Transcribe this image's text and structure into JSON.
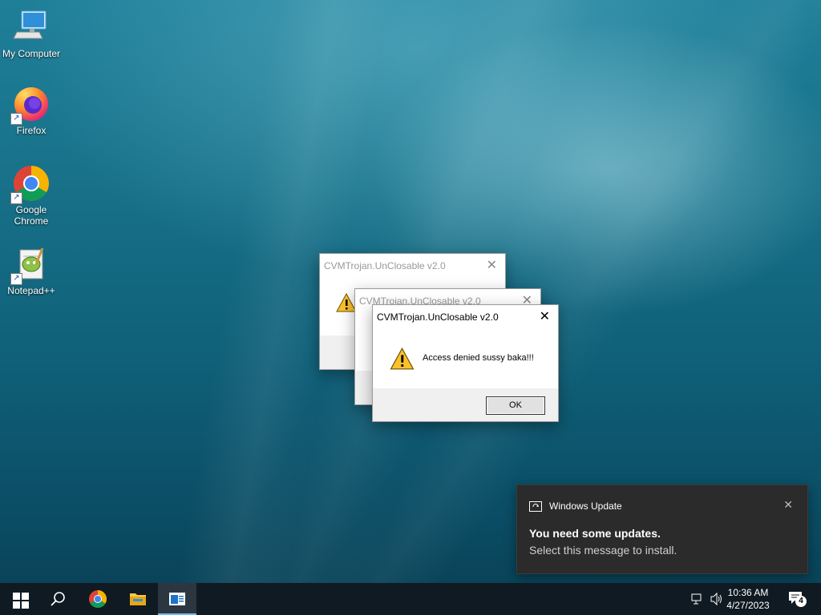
{
  "desktop": {
    "icons": [
      {
        "label": "My Computer",
        "icon": "computer-icon"
      },
      {
        "label": "Firefox",
        "icon": "firefox-icon"
      },
      {
        "label": "Google Chrome",
        "icon": "chrome-icon"
      },
      {
        "label": "Notepad++",
        "icon": "notepadpp-icon"
      }
    ],
    "shortcut_glyph": "↗"
  },
  "dialogs": [
    {
      "title": "CVMTrojan.UnClosable v2.0",
      "state": "inactive"
    },
    {
      "title": "CVMTrojan.UnClosable v2.0",
      "state": "inactive"
    },
    {
      "title": "CVMTrojan.UnClosable v2.0",
      "message": "Access denied sussy baka!!!",
      "ok_label": "OK",
      "state": "active"
    }
  ],
  "close_glyph": "✕",
  "toast": {
    "app": "Windows Update",
    "title": "You need some updates.",
    "body": "Select this message to install.",
    "close_glyph": "✕"
  },
  "taskbar": {
    "time": "10:36 AM",
    "date": "4/27/2023",
    "notification_count": "4",
    "accent": "#76b9ed"
  }
}
